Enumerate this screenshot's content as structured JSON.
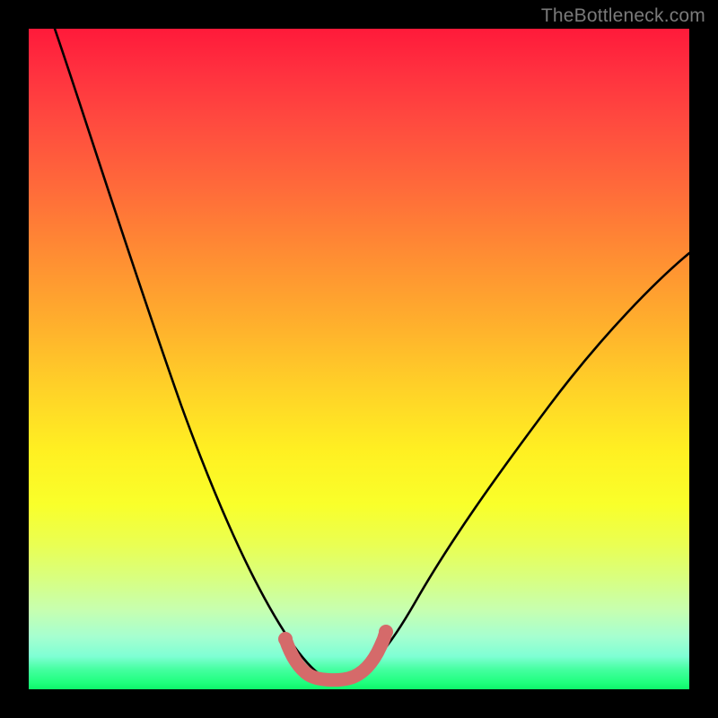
{
  "watermark": "TheBottleneck.com",
  "chart_data": {
    "type": "line",
    "title": "",
    "xlabel": "",
    "ylabel": "",
    "xlim": [
      0,
      100
    ],
    "ylim": [
      0,
      100
    ],
    "grid": false,
    "legend": false,
    "series": [
      {
        "name": "bottleneck-curve",
        "x": [
          4,
          10,
          16,
          22,
          28,
          33,
          37,
          40,
          42,
          44,
          46,
          50,
          52,
          56,
          60,
          66,
          74,
          82,
          90,
          100
        ],
        "y": [
          100,
          80,
          62,
          46,
          32,
          20,
          12,
          6,
          3,
          1.5,
          1.5,
          1.5,
          3,
          8,
          14,
          23,
          34,
          44,
          53,
          62
        ],
        "color": "#000000"
      },
      {
        "name": "optimal-zone-marker",
        "x": [
          39.5,
          40.5,
          41.5,
          43,
          45,
          48,
          50,
          51.5,
          52.5,
          53.2
        ],
        "y": [
          6.5,
          4.2,
          2.6,
          1.6,
          1.3,
          1.3,
          1.6,
          2.6,
          4.2,
          6.2
        ],
        "color": "#d56a6a"
      }
    ],
    "annotations": [
      {
        "text": "TheBottleneck.com",
        "pos": "top-right",
        "color": "#7a7a7a"
      }
    ]
  },
  "colors": {
    "frame": "#000000",
    "gradient_top": "#ff1a3a",
    "gradient_mid": "#ffe020",
    "gradient_bottom": "#0ef56a",
    "curve": "#000000",
    "zone_marker": "#d56a6a",
    "watermark": "#7a7a7a"
  }
}
